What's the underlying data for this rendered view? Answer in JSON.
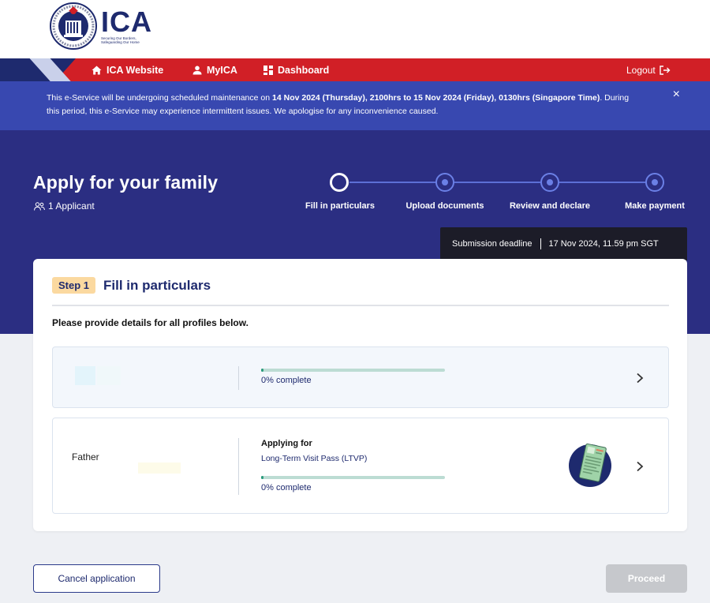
{
  "header": {
    "logo_text": "ICA",
    "logo_tagline_1": "Securing Our Borders,",
    "logo_tagline_2": "Safeguarding Our Home"
  },
  "nav": {
    "items": [
      {
        "label": "ICA Website",
        "icon": "home-icon"
      },
      {
        "label": "MyICA",
        "icon": "user-icon"
      },
      {
        "label": "Dashboard",
        "icon": "dashboard-icon"
      }
    ],
    "logout_label": "Logout"
  },
  "banner": {
    "text_1": "This e-Service will be undergoing scheduled maintenance on ",
    "bold_1": "14 Nov 2024 (Thursday), 2100hrs to 15 Nov 2024 (Friday), 0130hrs (Singapore Time)",
    "text_2": ". During this period, this e-Service may experience intermittent issues. We apologise for any inconvenience caused.",
    "close_label": "×"
  },
  "hero": {
    "title": "Apply for your family",
    "applicant_count": "1 Applicant",
    "steps": [
      {
        "label": "Fill in particulars",
        "active": true
      },
      {
        "label": "Upload documents",
        "active": false
      },
      {
        "label": "Review and declare",
        "active": false
      },
      {
        "label": "Make payment",
        "active": false
      }
    ],
    "deadline_label": "Submission deadline",
    "deadline_value": "17 Nov 2024, 11.59 pm SGT"
  },
  "card": {
    "step_badge": "Step 1",
    "step_title": "Fill in particulars",
    "instruction": "Please provide details for all profiles below.",
    "profiles": [
      {
        "name": "",
        "applying_for_label": "",
        "applying_for_value": "",
        "progress": 0,
        "progress_label": "0% complete"
      },
      {
        "name": "Father",
        "applying_for_label": "Applying for",
        "applying_for_value": "Long-Term Visit Pass (LTVP)",
        "progress": 0,
        "progress_label": "0% complete"
      }
    ]
  },
  "footer": {
    "cancel_label": "Cancel application",
    "proceed_label": "Proceed"
  },
  "colors": {
    "navy": "#1e2a6e",
    "hero_bg": "#2b2e82",
    "banner_bg": "#3848b0",
    "nav_red": "#d11f26",
    "progress_green": "#2a9b7c",
    "badge_yellow": "#fbd9a0"
  }
}
